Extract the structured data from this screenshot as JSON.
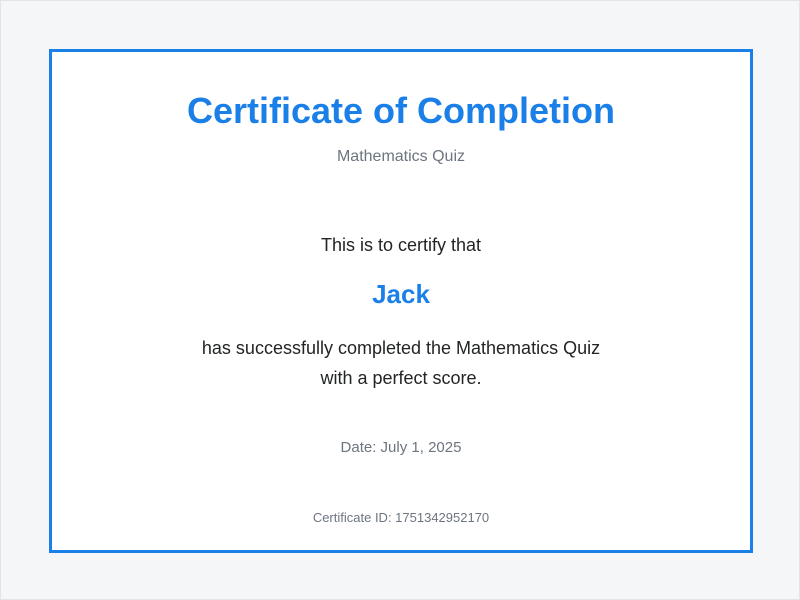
{
  "certificate": {
    "title": "Certificate of Completion",
    "subtitle": "Mathematics Quiz",
    "certify_text": "This is to certify that",
    "recipient": "Jack",
    "statement_line1": "has successfully completed the Mathematics Quiz",
    "statement_line2": "with a perfect score.",
    "date": "Date: July 1, 2025",
    "certificate_id": "Certificate ID: 1751342952170"
  },
  "colors": {
    "accent": "#1b7fe8",
    "page_background": "#f5f6f8",
    "card_background": "#ffffff",
    "body_text": "#222426",
    "muted_text": "#6c7580"
  }
}
